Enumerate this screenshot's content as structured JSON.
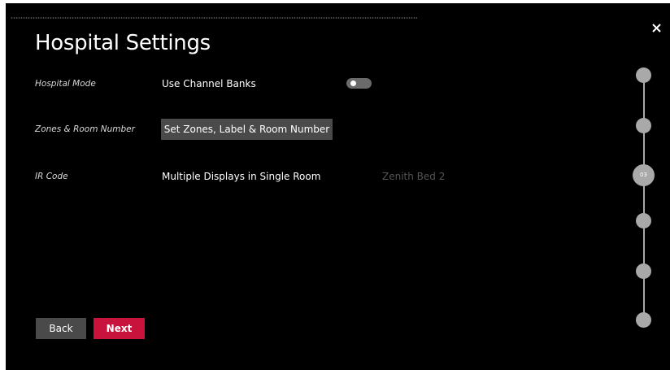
{
  "page": {
    "title": "Hospital Settings"
  },
  "rows": [
    {
      "label": "Hospital Mode",
      "text": "Use Channel Banks",
      "toggle_on": false
    },
    {
      "label": "Zones & Room Number",
      "button": "Set Zones, Label & Room Number"
    },
    {
      "label": "IR Code",
      "text": "Multiple Displays in Single Room",
      "value": "Zenith Bed 2"
    }
  ],
  "footer": {
    "back_label": "Back",
    "next_label": "Next"
  },
  "stepper": {
    "active_label": "03",
    "total_steps": 6,
    "active_step": 3
  },
  "icons": {
    "close": "close-icon"
  },
  "colors": {
    "background": "#000000",
    "button_gray": "#4a4a4a",
    "accent": "#c8143c",
    "stepper": "#a9a9a9"
  }
}
